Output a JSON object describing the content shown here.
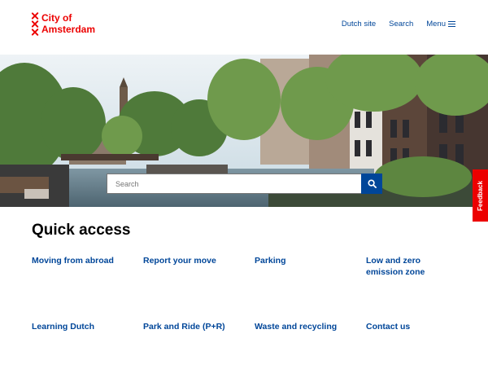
{
  "header": {
    "logo_line1": "City of",
    "logo_line2": "Amsterdam",
    "nav": {
      "dutch_site": "Dutch site",
      "search": "Search",
      "menu": "Menu"
    }
  },
  "hero": {
    "search_placeholder": "Search"
  },
  "feedback": "Feedback",
  "quick_access": {
    "title": "Quick access",
    "links": [
      "Moving from abroad",
      "Report your move",
      "Parking",
      "Low and zero emission zone",
      "Learning Dutch",
      "Park and Ride (P+R)",
      "Waste and recycling",
      "Contact us"
    ]
  },
  "colors": {
    "brand_red": "#ec0000",
    "link_blue": "#004699"
  }
}
